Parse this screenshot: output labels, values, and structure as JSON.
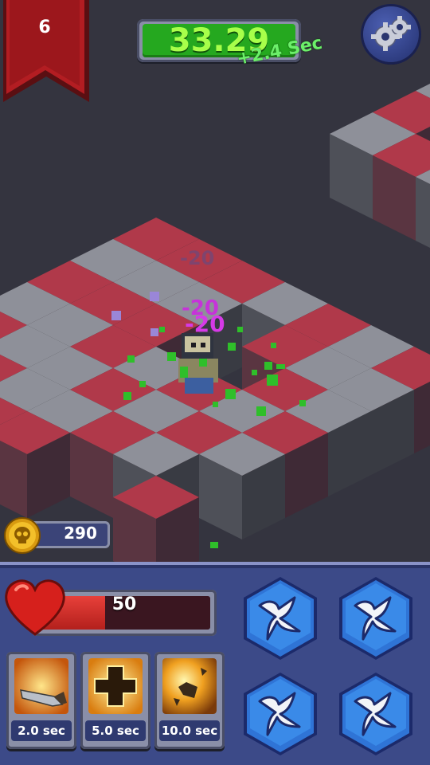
{
  "level": {
    "value": "6"
  },
  "timer": {
    "value": "33.29",
    "bonus": "+2.4 Sec"
  },
  "settings": {
    "icon": "gears-icon"
  },
  "damage_numbers": [
    "-20",
    "-20",
    "-20"
  ],
  "gold": {
    "value": "290",
    "icon": "skull-coin-icon"
  },
  "health": {
    "value": "50",
    "fill_fraction": 0.39,
    "icon": "heart-icon"
  },
  "skills": [
    {
      "cooldown": "2.0 sec",
      "icon": "blade-icon"
    },
    {
      "cooldown": "5.0 sec",
      "icon": "heal-cross-icon"
    },
    {
      "cooldown": "10.0 sec",
      "icon": "explosion-icon"
    }
  ],
  "attack_buttons": [
    {
      "icon": "shuriken-icon"
    },
    {
      "icon": "shuriken-icon"
    },
    {
      "icon": "shuriken-icon"
    },
    {
      "icon": "shuriken-icon"
    }
  ],
  "colors": {
    "background": "#34343f",
    "tile_red": "#b0394a",
    "tile_grey": "#8e9099",
    "timer_green": "#25a81f",
    "hud_blue": "#3c4a88",
    "damage_purple": "#c633d9"
  }
}
